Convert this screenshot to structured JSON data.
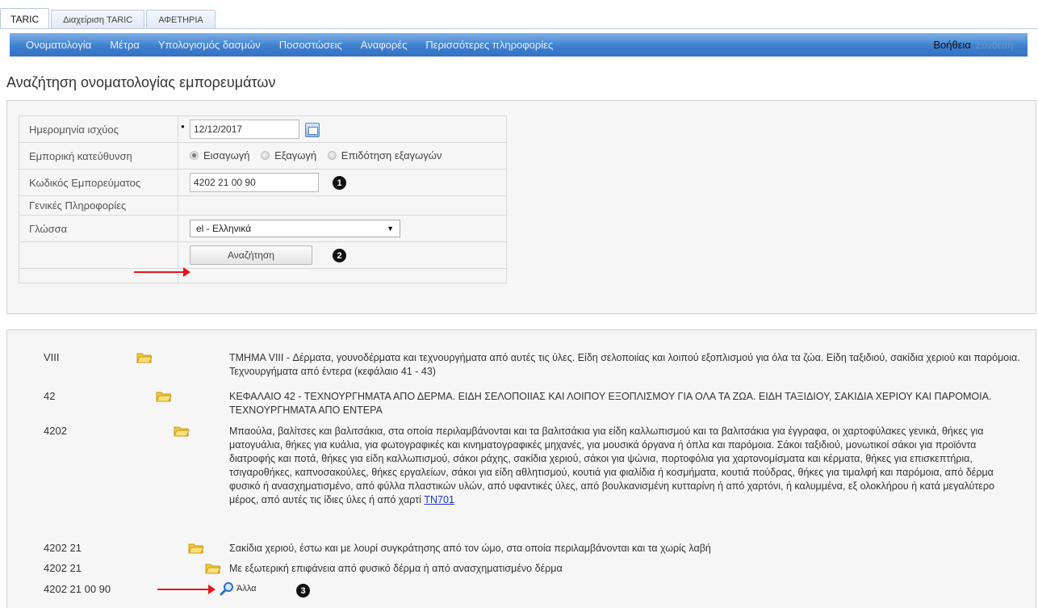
{
  "tabs": [
    {
      "label": "TARIC"
    },
    {
      "label": "Διαχείριση TARIC"
    },
    {
      "label": "ΑΦΕΤΗΡΙΑ"
    }
  ],
  "menu": {
    "items": [
      "Ονοματολογία",
      "Μέτρα",
      "Υπολογισμός δασμών",
      "Ποσοστώσεις",
      "Αναφορές",
      "Περισσότερες πληροφορίες"
    ],
    "help": "Βοήθεια",
    "login": "Σύνδεση"
  },
  "page_title": "Αναζήτηση ονοματολογίας εμπορευμάτων",
  "form": {
    "date_label": "Ημερομηνία ισχύος",
    "date_value": "12/12/2017",
    "direction_label": "Εμπορική κατεύθυνση",
    "direction_options": [
      "Εισαγωγή",
      "Εξαγωγή",
      "Επιδότηση εξαγωγών"
    ],
    "direction_selected": "Εισαγωγή",
    "code_label": "Κωδικός Εμπορεύματος",
    "code_value": "4202 21 00 90",
    "general_label": "Γενικές Πληροφορίες",
    "language_label": "Γλώσσα",
    "language_value": "el - Ελληνικά",
    "search_button": "Αναζήτηση"
  },
  "markers": [
    "1",
    "2",
    "3"
  ],
  "results": [
    {
      "code": "VIII",
      "desc": "ΤΜΗΜΑ VIII - Δέρματα, γουνοδέρματα και τεχνουργήματα από αυτές τις ύλες. Είδη σελοποιίας και λοιπού εξοπλισμού για όλα τα ζώα. Είδη ταξιδιού, σακίδια χεριού και παρόμοια. Τεχνουργήματα από έντερα (κεφάλαιο 41 - 43)"
    },
    {
      "code": "42",
      "desc": "ΚΕΦΑΛΑΙΟ 42 - ΤΕΧΝΟΥΡΓΗΜΑΤΑ ΑΠΟ ΔΕΡΜΑ. ΕΙΔΗ ΣΕΛΟΠΟΙΙΑΣ ΚΑΙ ΛΟΙΠΟΥ ΕΞΟΠΛΙΣΜΟΥ ΓΙΑ ΟΛΑ ΤΑ ΖΩΑ. ΕΙΔΗ ΤΑΞΙΔΙΟΥ, ΣΑΚΙΔΙΑ ΧΕΡΙΟΥ ΚΑΙ ΠΑΡΟΜΟΙΑ. ΤΕΧΝΟΥΡΓΗΜΑΤΑ ΑΠΟ ΕΝΤΕΡΑ"
    },
    {
      "code": "4202",
      "desc": "Μπαούλα, βαλίτσες και βαλιτσάκια, στα οποία περιλαμβάνονται και τα βαλιτσάκια για είδη καλλωπισμού και τα βαλιτσάκια για έγγραφα, οι χαρτοφύλακες γενικά, θήκες για ματογυάλια, θήκες για κυάλια, για φωτογραφικές και κινηματογραφικές μηχανές, για μουσικά όργανα ή όπλα και παρόμοια. Σάκοι ταξιδιού, μονωτικοί σάκοι για προϊόντα διατροφής και ποτά, θήκες για είδη καλλωπισμού, σάκοι ράχης, σακίδια χεριού, σάκοι για ψώνια, πορτοφόλια για χαρτονομίσματα και κέρματα, θήκες για επισκεπτήρια, τσιγαροθήκες, καπνοσακούλες, θήκες εργαλείων, σάκοι για είδη αθλητισμού, κουτιά για φιαλίδια ή κοσμήματα, κουτιά πούδρας, θήκες για τιμαλφή και παρόμοια, από δέρμα φυσικό ή ανασχηματισμένο, από φύλλα πλαστικών υλών, από υφαντικές ύλες, από βουλκανισμένη κυτταρίνη ή από χαρτόνι, ή καλυμμένα, εξ ολοκλήρου ή κατά μεγαλύτερο μέρος, από αυτές τις ίδιες ύλες ή από χαρτί",
      "link": "TN701"
    },
    {
      "code": "4202 21",
      "desc": "Σακίδια χεριού, έστω και με λουρί συγκράτησης από τον ώμο, στα οποία περιλαμβάνονται και τα χωρίς λαβή"
    },
    {
      "code": "4202 21",
      "desc": "Με εξωτερική επιφάνεια από φυσικό δέρμα ή από ανασχηματισμένο δέρμα"
    },
    {
      "code": "4202 21 00 90",
      "desc": "Άλλα"
    }
  ]
}
